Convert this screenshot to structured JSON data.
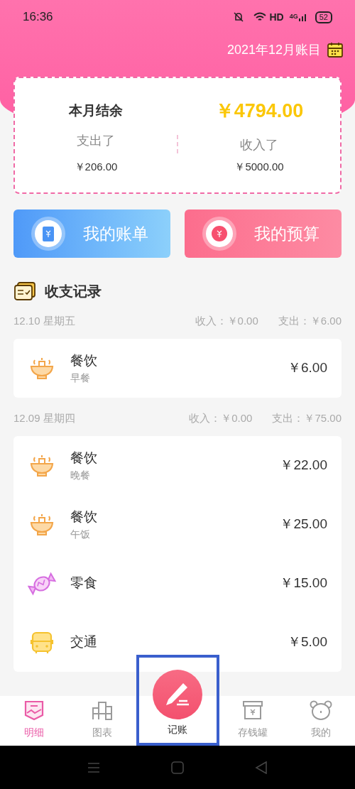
{
  "status_bar": {
    "time": "16:36",
    "network": "HD",
    "signal": "4G",
    "battery": "52"
  },
  "header": {
    "title": "2021年12月账目"
  },
  "summary": {
    "title": "本月结余",
    "balance": "￥4794.00",
    "expense_label": "支出了",
    "expense": "￥206.00",
    "income_label": "收入了",
    "income": "￥5000.00"
  },
  "shortcuts": [
    {
      "label": "我的账单",
      "kind": "bill"
    },
    {
      "label": "我的预算",
      "kind": "budget"
    }
  ],
  "records_title": "收支记录",
  "days": [
    {
      "date": "12.10 星期五",
      "income": "收入：￥0.00",
      "expense": "支出：￥6.00",
      "entries": [
        {
          "category": "餐饮",
          "note": "早餐",
          "amount": "￥6.00",
          "kind": "meal"
        }
      ]
    },
    {
      "date": "12.09 星期四",
      "income": "收入：￥0.00",
      "expense": "支出：￥75.00",
      "entries": [
        {
          "category": "餐饮",
          "note": "晚餐",
          "amount": "￥22.00",
          "kind": "meal"
        },
        {
          "category": "餐饮",
          "note": "午饭",
          "amount": "￥25.00",
          "kind": "meal"
        },
        {
          "category": "零食",
          "amount": "￥15.00",
          "kind": "snack"
        },
        {
          "category": "交通",
          "amount": "￥5.00",
          "kind": "transport"
        }
      ]
    }
  ],
  "tabs": [
    {
      "label": "明细",
      "kind": "detail",
      "selected": true,
      "highlighted": false
    },
    {
      "label": "图表",
      "kind": "chart",
      "selected": false,
      "highlighted": false
    },
    {
      "label": "记账",
      "kind": "add",
      "selected": false,
      "highlighted": true
    },
    {
      "label": "存钱罐",
      "kind": "savings",
      "selected": false,
      "highlighted": false
    },
    {
      "label": "我的",
      "kind": "profile",
      "selected": false,
      "highlighted": false
    }
  ]
}
